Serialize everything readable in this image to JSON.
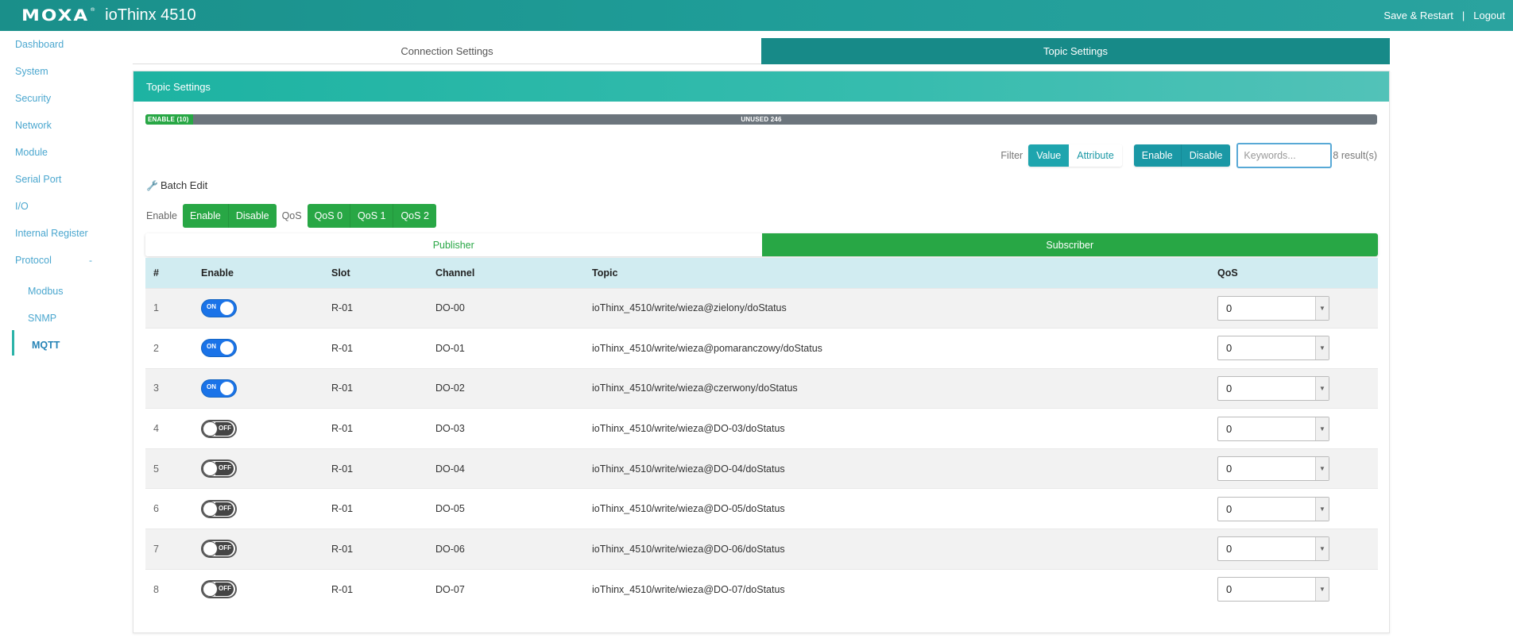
{
  "header": {
    "logo": "MOXA",
    "logo_mark": "®",
    "product": "ioThinx 4510",
    "save_restart": "Save & Restart",
    "separator": "|",
    "logout": "Logout"
  },
  "sidebar": {
    "items": [
      {
        "label": "Dashboard"
      },
      {
        "label": "System"
      },
      {
        "label": "Security"
      },
      {
        "label": "Network"
      },
      {
        "label": "Module"
      },
      {
        "label": "Serial Port"
      },
      {
        "label": "I/O"
      },
      {
        "label": "Internal Register"
      },
      {
        "label": "Protocol",
        "expanded_sign": "-"
      }
    ],
    "sub_items": [
      {
        "label": "Modbus"
      },
      {
        "label": "SNMP"
      },
      {
        "label": "MQTT",
        "active": true
      }
    ]
  },
  "main_tabs": [
    {
      "label": "Connection Settings",
      "active": false
    },
    {
      "label": "Topic Settings",
      "active": true
    }
  ],
  "panel": {
    "title": "Topic Settings",
    "usage": {
      "enabled_label": "ENABLE (10)",
      "unused_label": "UNUSED 246",
      "enabled_fraction": 0.039
    },
    "filter": {
      "label": "Filter",
      "value_btn": "Value",
      "attribute_btn": "Attribute",
      "enable_btn": "Enable",
      "disable_btn": "Disable",
      "keywords_placeholder": "Keywords...",
      "results": "8 result(s)"
    },
    "batch": {
      "title": "Batch Edit",
      "enable_label": "Enable",
      "enable_btn": "Enable",
      "disable_btn": "Disable",
      "qos_label": "QoS",
      "qos_btns": [
        "QoS 0",
        "QoS 1",
        "QoS 2"
      ]
    },
    "sub_tabs": [
      {
        "label": "Publisher",
        "active": false
      },
      {
        "label": "Subscriber",
        "active": true
      }
    ],
    "table": {
      "headers": {
        "num": "#",
        "enable": "Enable",
        "slot": "Slot",
        "channel": "Channel",
        "topic": "Topic",
        "qos": "QoS"
      },
      "toggle_on_text": "ON",
      "toggle_off_text": "OFF",
      "rows": [
        {
          "num": "1",
          "enabled": true,
          "slot": "R-01",
          "channel": "DO-00",
          "topic": "ioThinx_4510/write/wieza@zielony/doStatus",
          "qos": "0"
        },
        {
          "num": "2",
          "enabled": true,
          "slot": "R-01",
          "channel": "DO-01",
          "topic": "ioThinx_4510/write/wieza@pomaranczowy/doStatus",
          "qos": "0"
        },
        {
          "num": "3",
          "enabled": true,
          "slot": "R-01",
          "channel": "DO-02",
          "topic": "ioThinx_4510/write/wieza@czerwony/doStatus",
          "qos": "0"
        },
        {
          "num": "4",
          "enabled": false,
          "slot": "R-01",
          "channel": "DO-03",
          "topic": "ioThinx_4510/write/wieza@DO-03/doStatus",
          "qos": "0"
        },
        {
          "num": "5",
          "enabled": false,
          "slot": "R-01",
          "channel": "DO-04",
          "topic": "ioThinx_4510/write/wieza@DO-04/doStatus",
          "qos": "0"
        },
        {
          "num": "6",
          "enabled": false,
          "slot": "R-01",
          "channel": "DO-05",
          "topic": "ioThinx_4510/write/wieza@DO-05/doStatus",
          "qos": "0"
        },
        {
          "num": "7",
          "enabled": false,
          "slot": "R-01",
          "channel": "DO-06",
          "topic": "ioThinx_4510/write/wieza@DO-06/doStatus",
          "qos": "0"
        },
        {
          "num": "8",
          "enabled": false,
          "slot": "R-01",
          "channel": "DO-07",
          "topic": "ioThinx_4510/write/wieza@DO-07/doStatus",
          "qos": "0"
        }
      ]
    }
  },
  "colors": {
    "header_bg": "#1f9d98",
    "tab_active": "#178a88",
    "green": "#28a745",
    "teal_button": "#1ea5ae",
    "toggle_on": "#1a73e8",
    "table_header": "#d1ecf1",
    "sidebar_link": "#4ba7cf"
  }
}
